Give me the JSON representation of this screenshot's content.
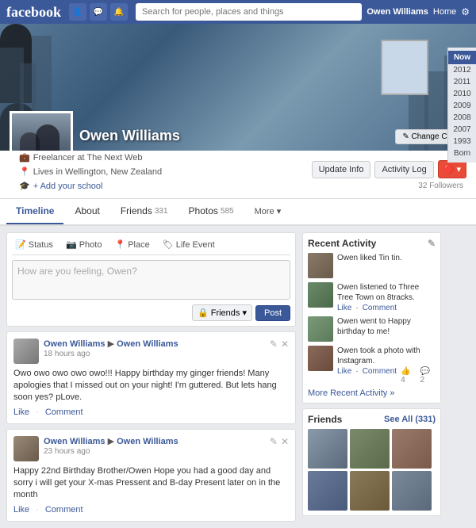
{
  "topnav": {
    "logo": "facebook",
    "search_placeholder": "Search for people, places and things",
    "user_name": "Owen Williams",
    "nav_home": "Home",
    "nav_icon1": "👤",
    "nav_icon2": "💬",
    "nav_icon3": "🔔"
  },
  "cover": {
    "change_cover_label": "✎ Change Cover"
  },
  "profile": {
    "name": "Owen Williams",
    "job": "Freelancer at The Next Web",
    "location": "Lives in Wellington, New Zealand",
    "school": "+ Add your school",
    "btn_update_info": "Update Info",
    "btn_activity_log": "Activity Log",
    "followers": "32 Followers"
  },
  "tabs": {
    "timeline": "Timeline",
    "about": "About",
    "friends": "Friends",
    "friends_count": "331",
    "photos": "Photos",
    "photos_count": "585",
    "more": "More ▾"
  },
  "year_bar": {
    "now": "Now",
    "years": [
      "2012",
      "2011",
      "2010",
      "2009",
      "2008",
      "2007",
      "1993",
      "Born"
    ]
  },
  "status_box": {
    "tab_status": "📝 Status",
    "tab_photo": "📷 Photo",
    "tab_place": "📍 Place",
    "tab_life": "🏷 Life Event",
    "placeholder": "How are you feeling, Owen?",
    "friends_btn": "🔒 Friends ▾",
    "post_btn": "Post"
  },
  "posts": [
    {
      "sender": "Owen Williams",
      "sender_ref": "Owen Williams",
      "time": "18 hours ago",
      "arrow": "▶ Owen Williams",
      "body": "Owo owo owo owo owo!!! Happy birthday my ginger friends! Many apologies that I missed out on your night! I'm guttered. But lets hang soon yes? pLove.",
      "like": "Like",
      "comment": "Comment"
    },
    {
      "sender": "Owen Williams",
      "sender_ref": "Owen Williams",
      "time": "23 hours ago",
      "arrow": "▶ Owen Williams",
      "body": "Happy 22nd Birthday Brother/Owen\nHope you had a good day and sorry i will get your X-mas Pressent and B-day Present later on in the month",
      "like": "Like",
      "comment": "Comment"
    }
  ],
  "recent_activity": {
    "title": "Recent Activity",
    "items": [
      {
        "text": "Owen liked Tin tin.",
        "has_actions": false
      },
      {
        "text": "Owen listened to Three Tree Town on 8tracks.",
        "like": "Like",
        "comment": "Comment",
        "has_actions": true
      },
      {
        "text": "Owen went to Happy birthday to me!",
        "has_actions": false
      },
      {
        "text": "Owen took a photo with Instagram.",
        "like": "Like",
        "comment": "Comment",
        "likes_count": "4",
        "comments_count": "2",
        "has_actions": true
      }
    ],
    "more_label": "More Recent Activity »"
  },
  "friends": {
    "title": "Friends",
    "see_all": "See All (331)",
    "count": "331"
  }
}
